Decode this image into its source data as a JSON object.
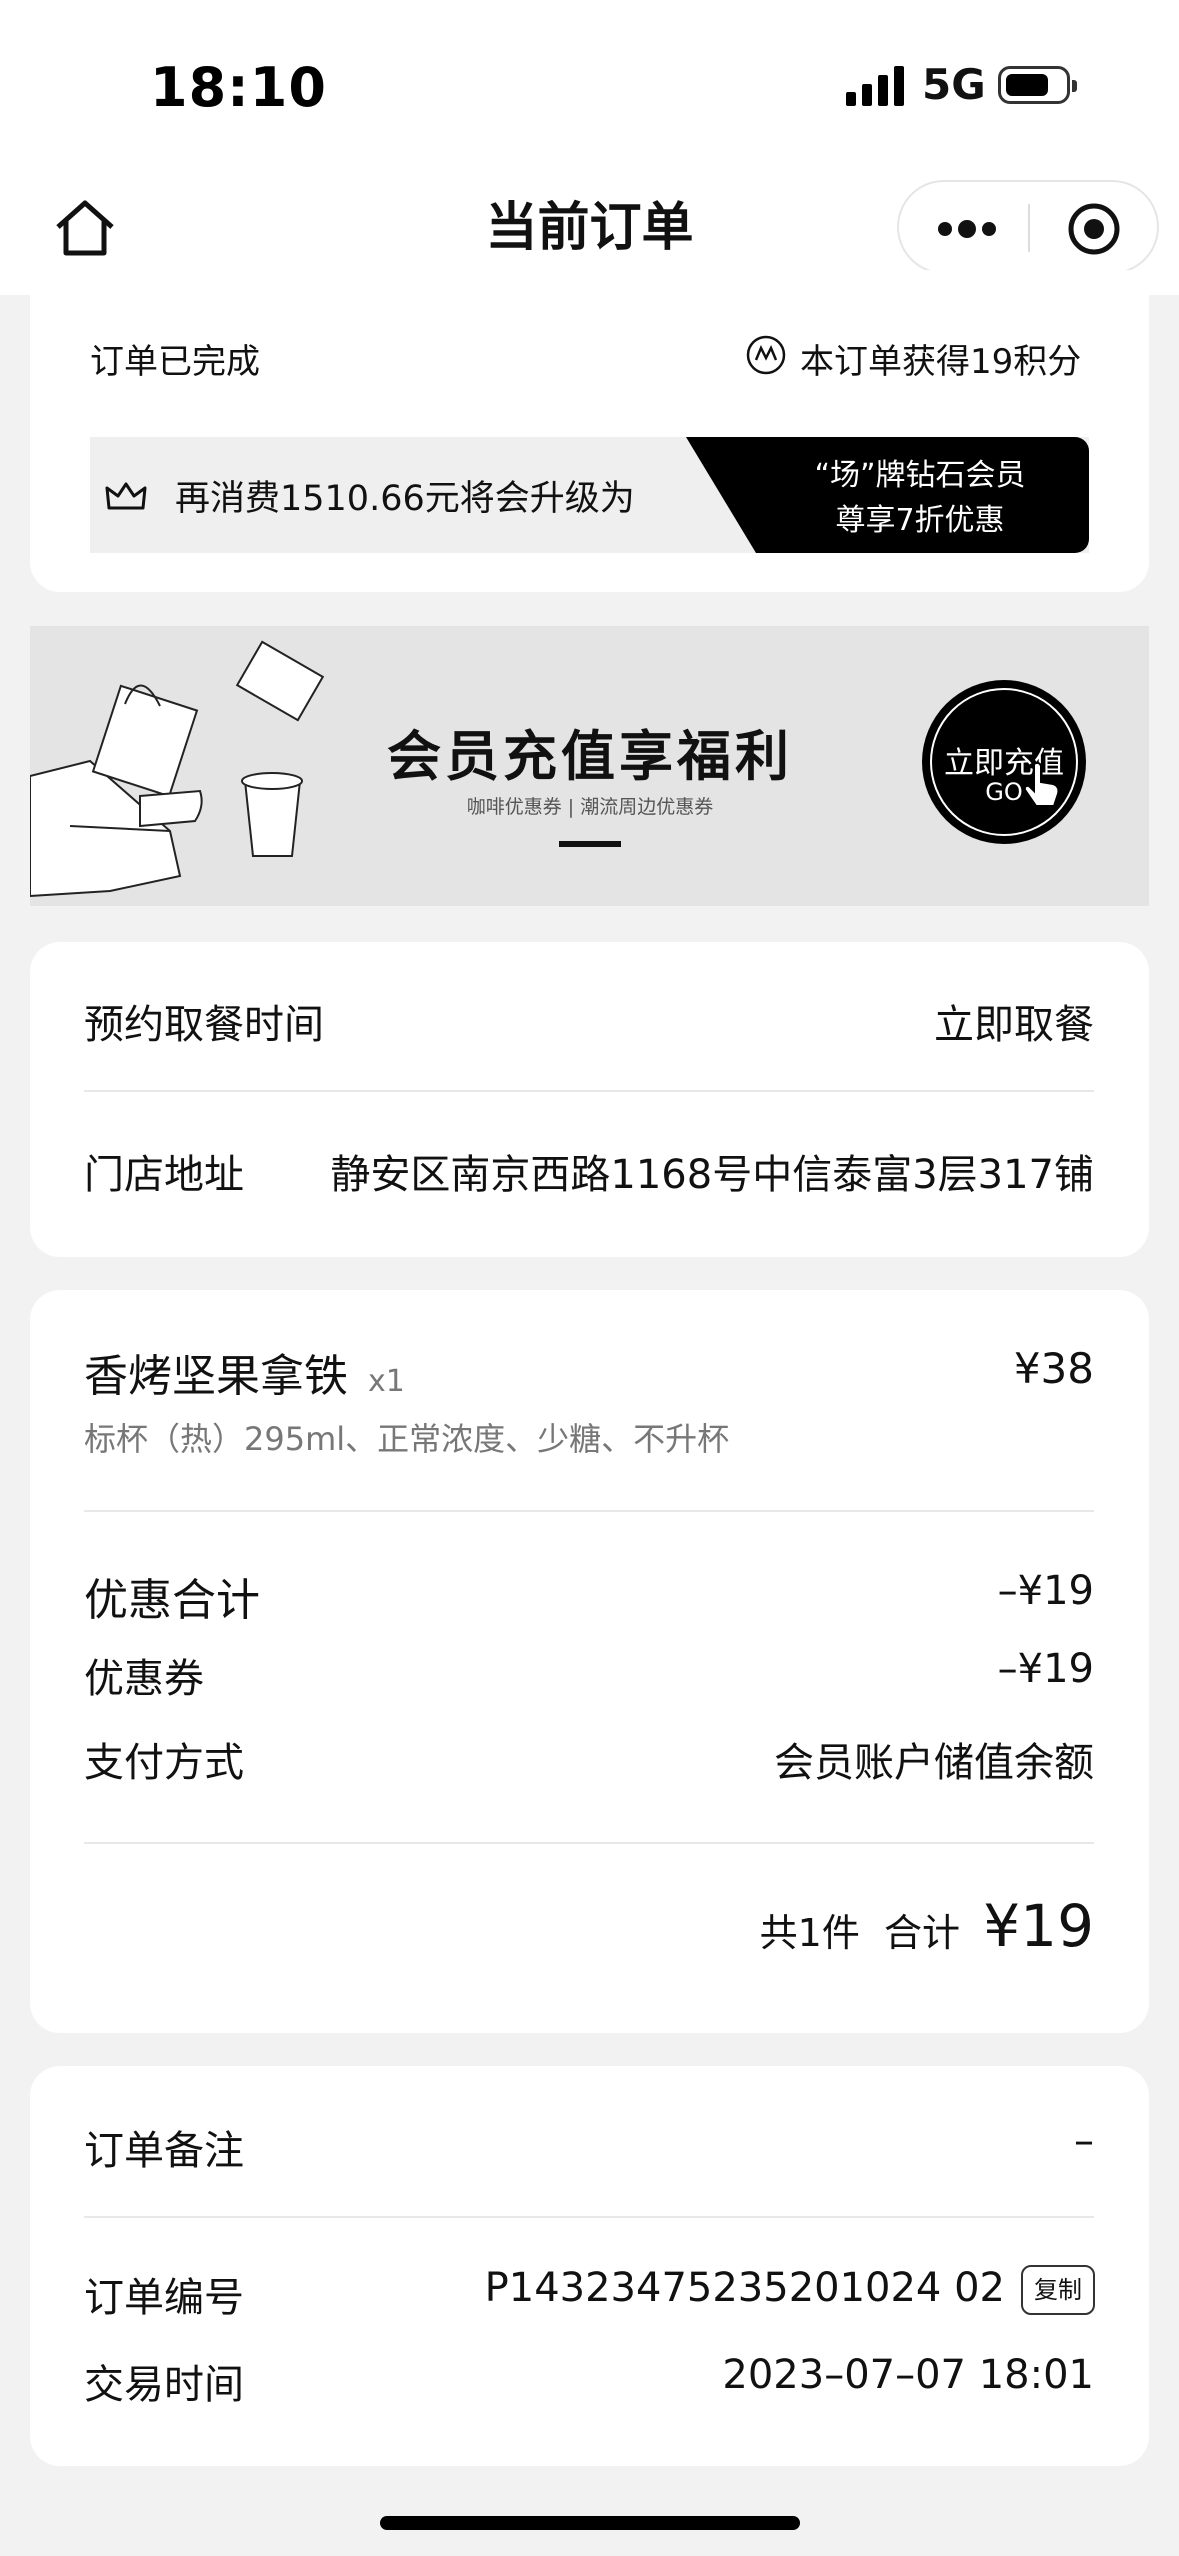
{
  "status_bar": {
    "time": "18:10",
    "network": "5G"
  },
  "nav": {
    "title": "当前订单"
  },
  "order_status": {
    "status": "订单已完成",
    "points": "本订单获得19积分"
  },
  "upgrade": {
    "text": "再消费1510.66元将会升级为",
    "level_line1": "“场”牌钻石会员",
    "level_line2": "尊享7折优惠"
  },
  "banner": {
    "title": "会员充值享福利",
    "subtitle": "咖啡优惠券 | 潮流周边优惠券",
    "go_label": "立即充值",
    "go_sub": "GO"
  },
  "pickup": {
    "time_label": "预约取餐时间",
    "time_value": "立即取餐",
    "store_label": "门店地址",
    "store_value": "静安区南京西路1168号中信泰富3层317铺"
  },
  "item": {
    "name": "香烤坚果拿铁",
    "qty": "x1",
    "price": "¥38",
    "spec": "标杯（热）295ml、正常浓度、少糖、不升杯"
  },
  "summary": {
    "discount_label": "优惠合计",
    "discount_value": "–¥19",
    "coupon_label": "优惠券",
    "coupon_value": "–¥19",
    "payment_label": "支付方式",
    "payment_value": "会员账户储值余额",
    "count_label": "共1件  合计",
    "total": "¥19"
  },
  "details": {
    "remark_label": "订单备注",
    "remark_value": "–",
    "order_no_label": "订单编号",
    "order_no_value": "P14323475235201024 02",
    "copy_label": "复制",
    "time_label": "交易时间",
    "time_value": "2023–07–07 18:01"
  }
}
